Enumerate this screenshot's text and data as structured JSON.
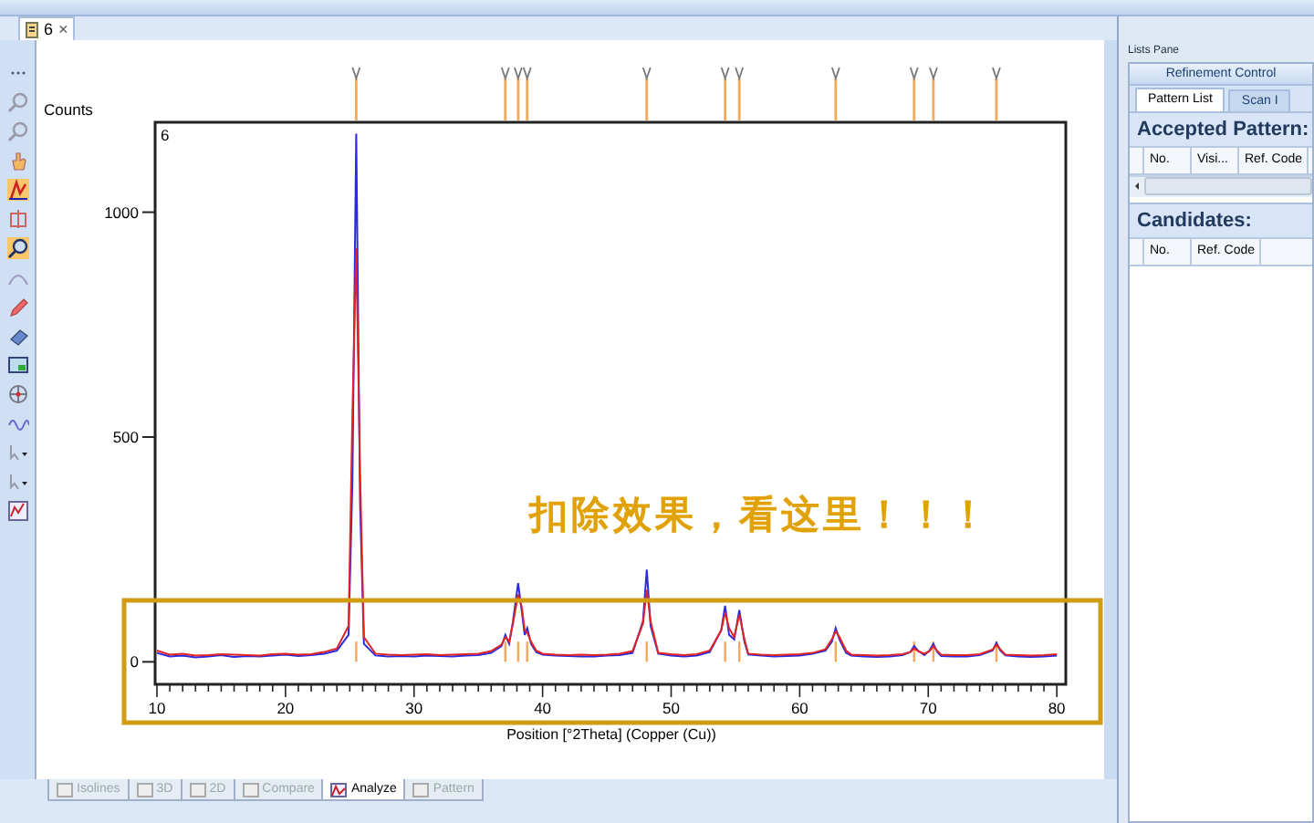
{
  "document_tab": {
    "label": "6",
    "close": "×"
  },
  "chart": {
    "plot_label": "6",
    "note": "扣除效果，看这里！！！",
    "chart_data": {
      "type": "line",
      "ylabel": "Counts",
      "xlabel": "Position [°2Theta] (Copper (Cu))",
      "xlim": [
        10,
        80.7
      ],
      "ylim": [
        -50,
        1200
      ],
      "xticks": [
        10,
        20,
        30,
        40,
        50,
        60,
        70,
        80
      ],
      "yticks": [
        0,
        500,
        1000
      ],
      "x": [
        10,
        11,
        12,
        13,
        14,
        15,
        16,
        17,
        18,
        19,
        20,
        21,
        22,
        23,
        24,
        24.9,
        25.2,
        25.5,
        25.8,
        26.1,
        27,
        28,
        29,
        30,
        31,
        32,
        33,
        34,
        35,
        36,
        36.8,
        37.1,
        37.4,
        37.7,
        38.1,
        38.4,
        38.6,
        38.8,
        39.1,
        39.5,
        40,
        41,
        42,
        43,
        44,
        45,
        46,
        47,
        47.8,
        48.1,
        48.4,
        49,
        50,
        51,
        52,
        53,
        53.9,
        54.2,
        54.5,
        54.9,
        55.3,
        55.7,
        56,
        57,
        58,
        59,
        60,
        61,
        62,
        62.5,
        62.8,
        63.1,
        63.6,
        64,
        65,
        66,
        67,
        68,
        68.6,
        68.9,
        69.2,
        69.7,
        70.1,
        70.4,
        70.7,
        71,
        72,
        73,
        74,
        75,
        75.3,
        75.6,
        76,
        77,
        78,
        79,
        80
      ],
      "series": [
        {
          "color": "#2a2ae0",
          "values": [
            20,
            12,
            14,
            10,
            12,
            15,
            11,
            13,
            12,
            14,
            16,
            13,
            15,
            18,
            25,
            60,
            400,
            1175,
            350,
            40,
            14,
            12,
            13,
            12,
            14,
            13,
            12,
            14,
            15,
            20,
            35,
            60,
            40,
            90,
            175,
            110,
            60,
            75,
            40,
            22,
            16,
            14,
            13,
            12,
            12,
            14,
            15,
            20,
            90,
            205,
            80,
            18,
            14,
            12,
            14,
            22,
            70,
            125,
            60,
            50,
            115,
            45,
            16,
            14,
            12,
            13,
            14,
            18,
            25,
            45,
            75,
            50,
            20,
            14,
            12,
            11,
            12,
            15,
            22,
            35,
            25,
            15,
            25,
            40,
            22,
            13,
            12,
            12,
            15,
            25,
            42,
            25,
            14,
            12,
            11,
            12,
            14
          ]
        },
        {
          "color": "#e02424",
          "values": [
            25,
            16,
            18,
            14,
            15,
            17,
            16,
            15,
            14,
            17,
            18,
            16,
            17,
            22,
            30,
            80,
            550,
            920,
            420,
            55,
            18,
            16,
            15,
            16,
            17,
            15,
            16,
            17,
            18,
            24,
            38,
            55,
            45,
            85,
            150,
            120,
            70,
            65,
            45,
            25,
            18,
            16,
            15,
            16,
            15,
            16,
            18,
            24,
            85,
            160,
            90,
            20,
            17,
            15,
            17,
            25,
            70,
            110,
            75,
            55,
            105,
            50,
            18,
            16,
            15,
            16,
            17,
            20,
            28,
            50,
            68,
            55,
            25,
            16,
            15,
            14,
            15,
            17,
            22,
            30,
            24,
            18,
            24,
            35,
            24,
            16,
            15,
            15,
            17,
            27,
            38,
            28,
            16,
            15,
            14,
            15,
            17
          ]
        }
      ]
    }
  },
  "view_tabs": [
    {
      "label": "Isolines",
      "selected": false
    },
    {
      "label": "3D",
      "selected": false
    },
    {
      "label": "2D",
      "selected": false
    },
    {
      "label": "Compare",
      "selected": false
    },
    {
      "label": "Analyze",
      "selected": true
    },
    {
      "label": "Pattern",
      "selected": false
    }
  ],
  "lists_pane": {
    "title": "Lists Pane",
    "top_tab": "Refinement Control",
    "tabs": [
      {
        "label": "Pattern List",
        "selected": true
      },
      {
        "label": "Scan I",
        "selected": false
      }
    ],
    "sections": [
      {
        "title": "Accepted Pattern:",
        "columns": [
          "No.",
          "Visi...",
          "Ref. Code"
        ]
      },
      {
        "title": "Candidates:",
        "columns": [
          "No.",
          "Ref. Code"
        ]
      }
    ]
  }
}
